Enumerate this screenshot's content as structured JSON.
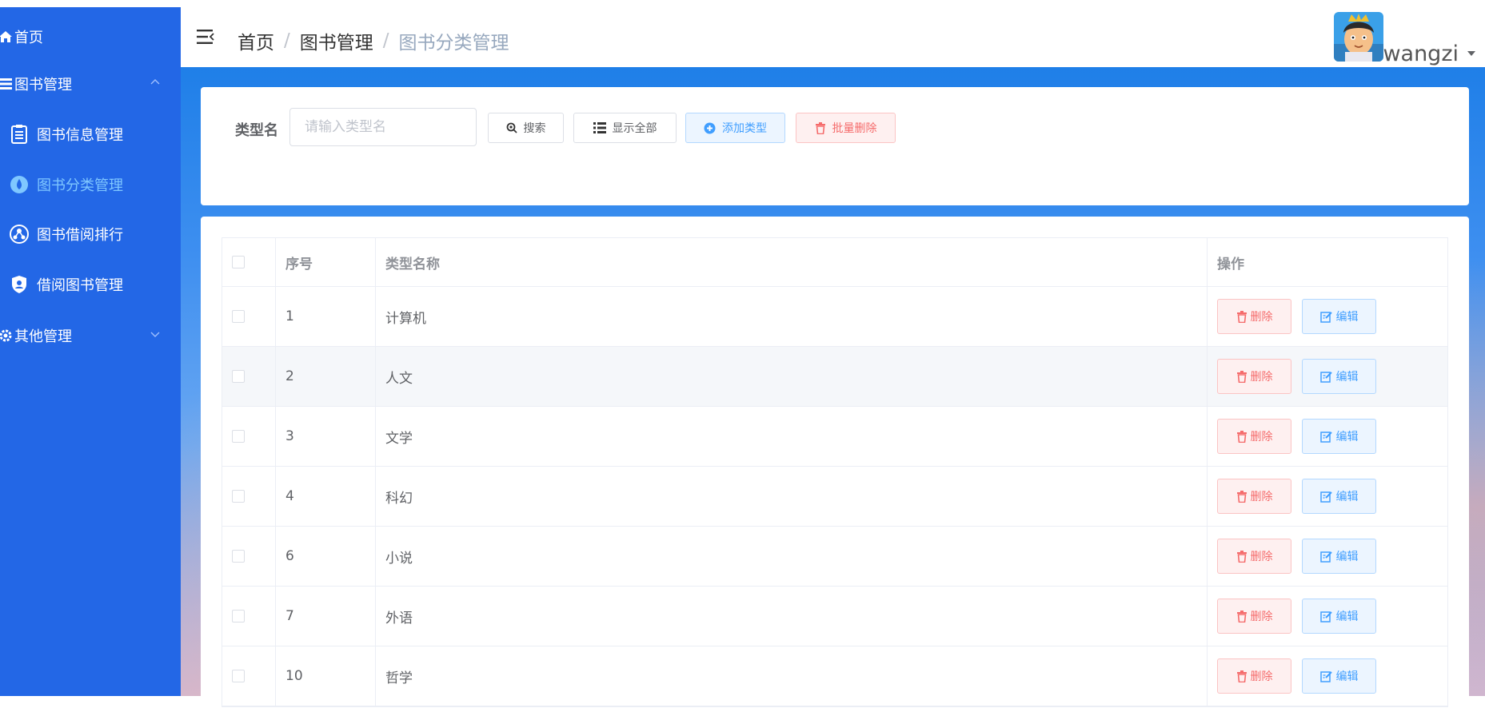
{
  "sidebar": {
    "items": [
      {
        "label": "首页",
        "icon": "home-icon"
      },
      {
        "label": "图书管理",
        "icon": "books-icon",
        "expanded": true
      },
      {
        "label": "图书信息管理",
        "icon": "document-icon"
      },
      {
        "label": "图书分类管理",
        "icon": "category-icon",
        "active": true
      },
      {
        "label": "图书借阅排行",
        "icon": "ranking-icon"
      },
      {
        "label": "借阅图书管理",
        "icon": "shield-icon"
      },
      {
        "label": "其他管理",
        "icon": "gear-icon",
        "expanded": false
      }
    ]
  },
  "header": {
    "breadcrumb": [
      "首页",
      "图书管理",
      "图书分类管理"
    ],
    "username": "wangzi"
  },
  "search": {
    "label": "类型名",
    "placeholder": "请输入类型名",
    "buttons": {
      "search": "搜索",
      "show_all": "显示全部",
      "add_type": "添加类型",
      "batch_delete": "批量删除"
    }
  },
  "table": {
    "headers": [
      "序号",
      "类型名称",
      "操作"
    ],
    "rows": [
      {
        "id": "1",
        "name": "计算机"
      },
      {
        "id": "2",
        "name": "人文"
      },
      {
        "id": "3",
        "name": "文学"
      },
      {
        "id": "4",
        "name": "科幻"
      },
      {
        "id": "6",
        "name": "小说"
      },
      {
        "id": "7",
        "name": "外语"
      },
      {
        "id": "10",
        "name": "哲学"
      }
    ],
    "actions": {
      "delete": "删除",
      "edit": "编辑"
    }
  },
  "colors": {
    "sidebar": "#2367e6",
    "active_menu": "#7fc7ff",
    "primary": "#409eff",
    "danger": "#f56c6c"
  }
}
